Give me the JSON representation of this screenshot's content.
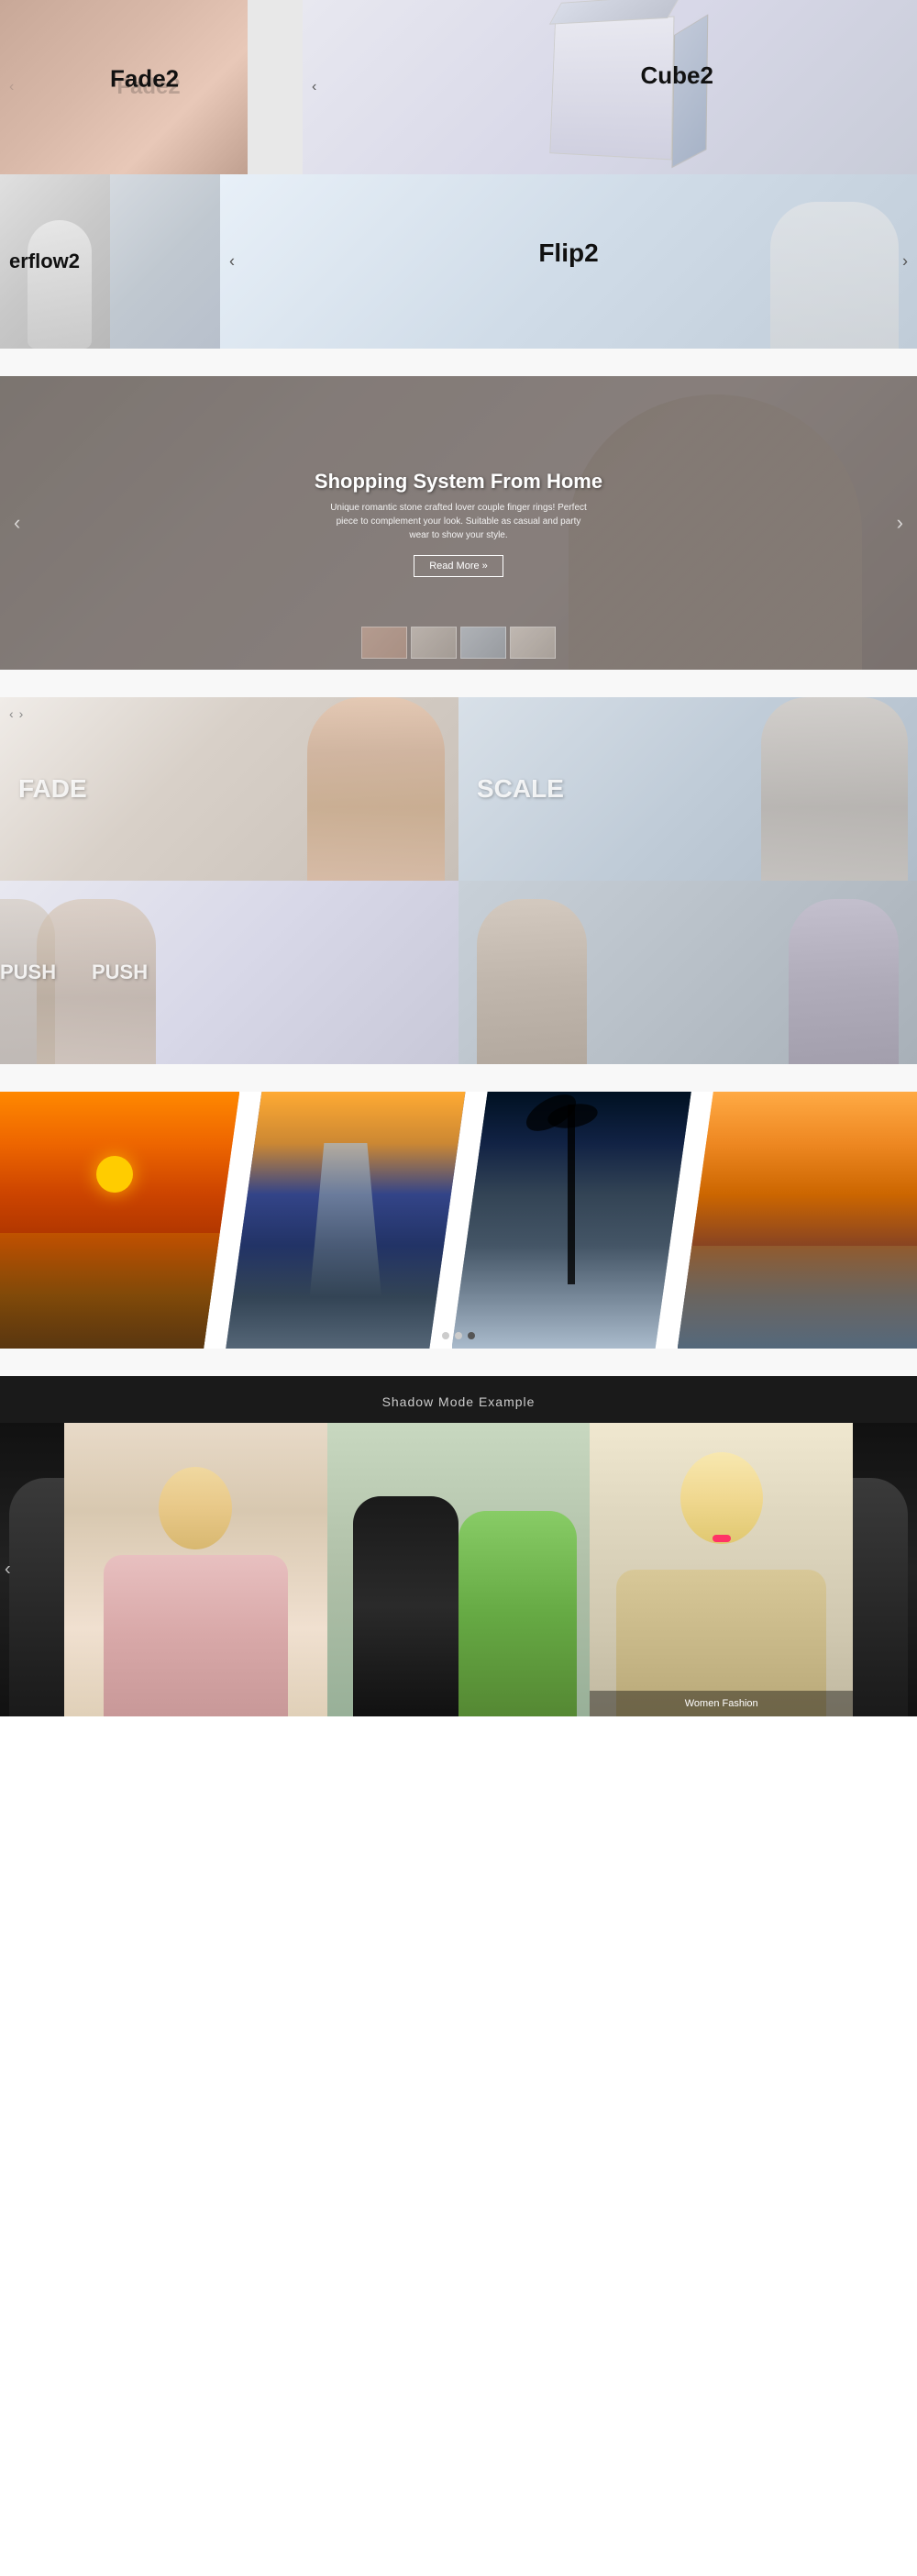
{
  "section1": {
    "labels": {
      "fade2": "Fade2",
      "cube2": "Cube2",
      "overflow2": "erflow2",
      "flip2": "Flip2"
    },
    "arrows": {
      "left": "‹",
      "right": "›"
    }
  },
  "section2": {
    "title": "Shopping System From Home",
    "subtitle": "Unique romantic stone crafted lover couple finger rings! Perfect piece to complement your look. Suitable as casual and party wear to show your style.",
    "button": "Read More »",
    "nav_left": "‹",
    "nav_right": "›"
  },
  "section3": {
    "labels": {
      "fade": "FADE",
      "scale": "SCALE",
      "push1": "PUSH",
      "push2": "PUSH"
    }
  },
  "section4": {
    "dots": [
      "dot1",
      "dot2",
      "dot3"
    ],
    "active_dot": 2
  },
  "section5": {
    "title": "Shadow Mode Example",
    "caption": "Women Fashion",
    "nav_left": "‹"
  }
}
